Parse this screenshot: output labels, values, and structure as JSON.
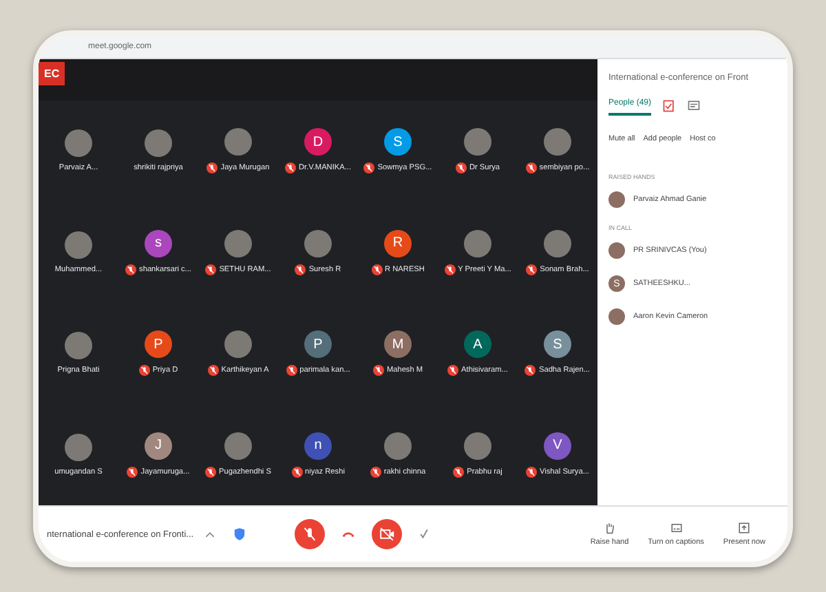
{
  "browser": {
    "url": "meet.google.com"
  },
  "meeting": {
    "recording_badge": "EC",
    "tiles": [
      {
        "name": "Parvaiz A...",
        "kind": "photo",
        "muted": false
      },
      {
        "name": "shrikiti rajpriya",
        "kind": "photo",
        "muted": false
      },
      {
        "name": "Jaya Murugan",
        "kind": "photo",
        "muted": true
      },
      {
        "name": "Dr.V.MANIKA...",
        "kind": "letter",
        "letter": "D",
        "color": "#d81b60",
        "muted": true
      },
      {
        "name": "Sowmya PSG...",
        "kind": "letter",
        "letter": "S",
        "color": "#039be5",
        "muted": true
      },
      {
        "name": "Dr Surya",
        "kind": "photo",
        "muted": true
      },
      {
        "name": "sembiyan po...",
        "kind": "photo",
        "muted": true
      },
      {
        "name": "Muhammed...",
        "kind": "photo",
        "muted": false
      },
      {
        "name": "shankarsari c...",
        "kind": "letter",
        "letter": "s",
        "color": "#ab47bc",
        "muted": true
      },
      {
        "name": "SETHU RAM...",
        "kind": "photo",
        "muted": true
      },
      {
        "name": "Suresh R",
        "kind": "photo",
        "muted": true
      },
      {
        "name": "R NARESH",
        "kind": "letter",
        "letter": "R",
        "color": "#e64a19",
        "muted": true
      },
      {
        "name": "Y Preeti Y Ma...",
        "kind": "photo",
        "muted": true
      },
      {
        "name": "Sonam Brah...",
        "kind": "photo",
        "muted": true
      },
      {
        "name": "Prigna Bhati",
        "kind": "photo",
        "muted": false
      },
      {
        "name": "Priya D",
        "kind": "letter",
        "letter": "P",
        "color": "#e64a19",
        "muted": true
      },
      {
        "name": "Karthikeyan A",
        "kind": "photo",
        "muted": true
      },
      {
        "name": "parimala kan...",
        "kind": "letter",
        "letter": "P",
        "color": "#546e7a",
        "muted": true
      },
      {
        "name": "Mahesh M",
        "kind": "letter",
        "letter": "M",
        "color": "#8d6e63",
        "muted": true
      },
      {
        "name": "Athisivaram...",
        "kind": "letter",
        "letter": "A",
        "color": "#00695c",
        "muted": true
      },
      {
        "name": "Sadha Rajen...",
        "kind": "letter",
        "letter": "S",
        "color": "#78909c",
        "muted": true
      },
      {
        "name": "umugandan S",
        "kind": "photo",
        "muted": false
      },
      {
        "name": "Jayamuruga...",
        "kind": "letter",
        "letter": "J",
        "color": "#a1887f",
        "muted": true
      },
      {
        "name": "Pugazhendhi S",
        "kind": "photo",
        "muted": true
      },
      {
        "name": "niyaz Reshi",
        "kind": "letter",
        "letter": "n",
        "color": "#3f51b5",
        "muted": true
      },
      {
        "name": "rakhi chinna",
        "kind": "photo",
        "muted": true
      },
      {
        "name": "Prabhu raj",
        "kind": "photo",
        "muted": true
      },
      {
        "name": "Vishal Surya...",
        "kind": "letter",
        "letter": "V",
        "color": "#7e57c2",
        "muted": true
      }
    ]
  },
  "panel": {
    "title": "International e-conference on Front",
    "tabs": [
      {
        "label": "People (49)",
        "selected": true
      }
    ],
    "actions": [
      "Mute all",
      "Add people",
      "Host co"
    ],
    "sections": [
      {
        "heading": "RAISED HANDS",
        "people": [
          {
            "name": "Parvaiz Ahmad Ganie",
            "kind": "photo"
          }
        ]
      },
      {
        "heading": "IN CALL",
        "people": [
          {
            "name": "PR SRINIVCAS (You)",
            "kind": "photo"
          },
          {
            "name": "SATHEESHKU...",
            "kind": "letter",
            "letter": "S"
          },
          {
            "name": "Aaron Kevin Cameron",
            "kind": "photo"
          }
        ]
      }
    ]
  },
  "bottom_bar": {
    "meeting_title": "nternational e-conference on Fronti...",
    "buttons": [
      "Raise hand",
      "Turn on captions",
      "Present now"
    ]
  }
}
